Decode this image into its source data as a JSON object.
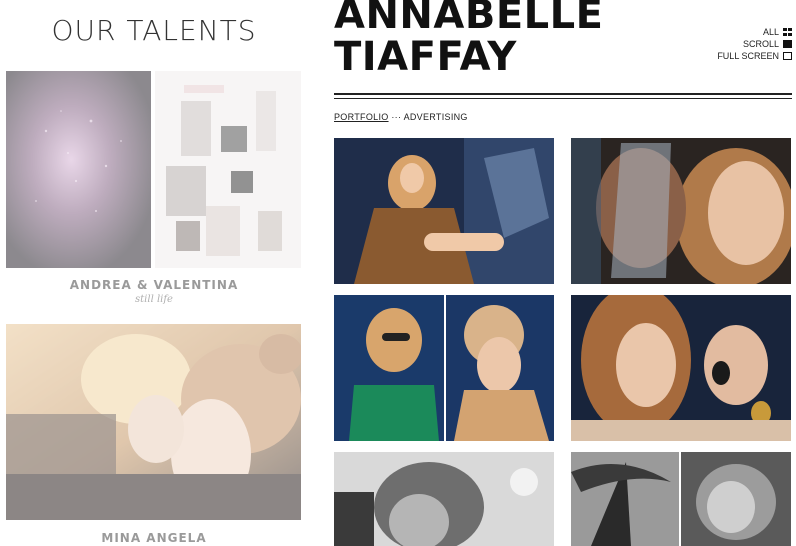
{
  "talents": {
    "title": "OUR TALENTS",
    "items": [
      {
        "name": "ANDREA & VALENTINA",
        "subtitle": "still life"
      },
      {
        "name": "MINA ANGELA",
        "subtitle": ""
      }
    ]
  },
  "artist": {
    "line1": "ANNABELLE",
    "line2": "TIAFFAY"
  },
  "view_menu": {
    "all": "ALL",
    "scroll": "SCROLL",
    "full_screen": "FULL SCREEN"
  },
  "breadcrumb": {
    "portfolio": "PORTFOLIO",
    "separator": "···",
    "current": "ADVERTISING"
  },
  "colors": {
    "accent": "#111111",
    "muted_text": "#9a9a9a",
    "background": "#ffffff"
  }
}
